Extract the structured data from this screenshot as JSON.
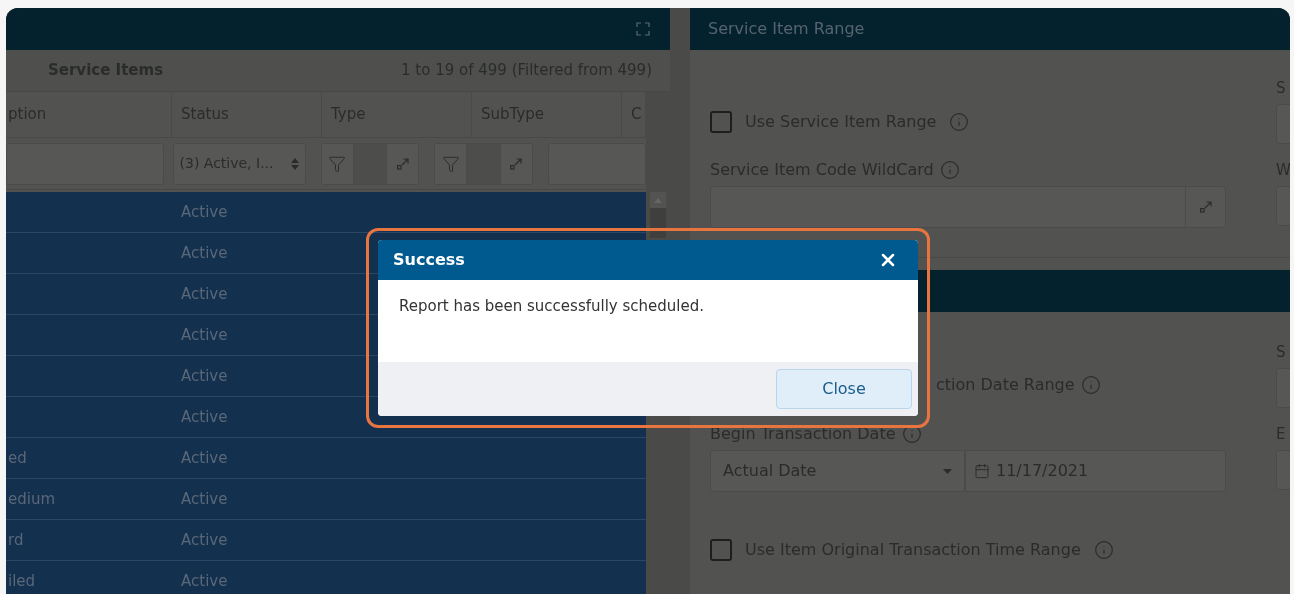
{
  "grid": {
    "title": "Service Items",
    "count": "1 to 19 of 499 (Filtered from 499)",
    "columns": [
      {
        "label": "ption"
      },
      {
        "label": "Status"
      },
      {
        "label": "Type"
      },
      {
        "label": "SubType"
      },
      {
        "label": "C"
      }
    ],
    "filters": [
      {
        "kind": "text"
      },
      {
        "kind": "select",
        "value": "(3) Active, I..."
      },
      {
        "kind": "filter"
      },
      {
        "kind": "filter"
      },
      {
        "kind": "partial"
      }
    ],
    "rows": [
      {
        "status": "Active",
        "selected": true
      },
      {
        "status": "Active",
        "selected": true
      },
      {
        "status": "Active",
        "selected": true
      },
      {
        "status": "Active",
        "selected": true
      },
      {
        "status": "Active",
        "selected": true
      },
      {
        "status": "Active",
        "selected": true
      },
      {
        "description": "ed",
        "status": "Active",
        "selected": true
      },
      {
        "description": "edium",
        "status": "Active",
        "selected": true
      },
      {
        "description": "rd",
        "status": "Active",
        "selected": true
      },
      {
        "description": "iled",
        "status": "Active",
        "selected": true
      }
    ]
  },
  "service_item_range": {
    "title": "Service Item Range",
    "use_range": {
      "label": "Use Service Item Range",
      "checked": false
    },
    "wildcard_label": "Service Item Code WildCard",
    "side_labels": [
      "S",
      "W"
    ]
  },
  "transaction_section": {
    "date_range_label": "ction Date Range",
    "begin_label": "Begin Transaction Date",
    "begin_mode": "Actual Date",
    "begin_date": "11/17/2021",
    "time_range": {
      "label": "Use Item Original Transaction Time Range",
      "checked": false
    },
    "side_labels": [
      "S",
      "E"
    ]
  },
  "dialog": {
    "title": "Success",
    "message": "Report has been successfully scheduled.",
    "button": "Close"
  }
}
